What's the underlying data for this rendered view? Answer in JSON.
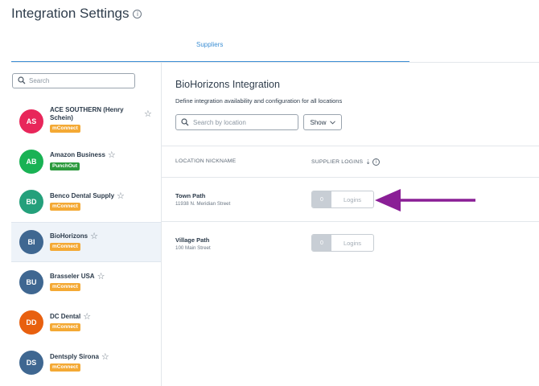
{
  "page": {
    "title": "Integration Settings"
  },
  "tabs": [
    {
      "label": "Suppliers",
      "active": true
    }
  ],
  "sidebar": {
    "search_placeholder": "Search",
    "suppliers": [
      {
        "initials": "AS",
        "name": "ACE SOUTHERN (Henry Schein)",
        "badge": "mConnect",
        "badge_type": "orange",
        "avatar_color": "#e8265a"
      },
      {
        "initials": "AB",
        "name": "Amazon Business",
        "badge": "PunchOut",
        "badge_type": "green",
        "avatar_color": "#19b254"
      },
      {
        "initials": "BD",
        "name": "Benco Dental Supply",
        "badge": "mConnect",
        "badge_type": "orange",
        "avatar_color": "#24a07b"
      },
      {
        "initials": "BI",
        "name": "BioHorizons",
        "badge": "mConnect",
        "badge_type": "orange",
        "avatar_color": "#3f6791",
        "selected": true
      },
      {
        "initials": "BU",
        "name": "Brasseler USA",
        "badge": "mConnect",
        "badge_type": "orange",
        "avatar_color": "#3f6791"
      },
      {
        "initials": "DD",
        "name": "DC Dental",
        "badge": "mConnect",
        "badge_type": "orange",
        "avatar_color": "#e8600f"
      },
      {
        "initials": "DS",
        "name": "Dentsply Sirona",
        "badge": "mConnect",
        "badge_type": "orange",
        "avatar_color": "#3f6791"
      }
    ]
  },
  "main": {
    "title": "BioHorizons Integration",
    "description": "Define integration availability and configuration for all locations",
    "search_placeholder": "Search by location",
    "show_label": "Show",
    "columns": {
      "location": "LOCATION NICKNAME",
      "logins": "SUPPLIER LOGINS"
    },
    "locations": [
      {
        "name": "Town Path",
        "address": "11938 N. Meridian Street",
        "count": "0",
        "logins_label": "Logins"
      },
      {
        "name": "Village Path",
        "address": "100 Main Street",
        "count": "0",
        "logins_label": "Logins"
      }
    ]
  },
  "annotation": {
    "arrow_color": "#8a1f96"
  }
}
